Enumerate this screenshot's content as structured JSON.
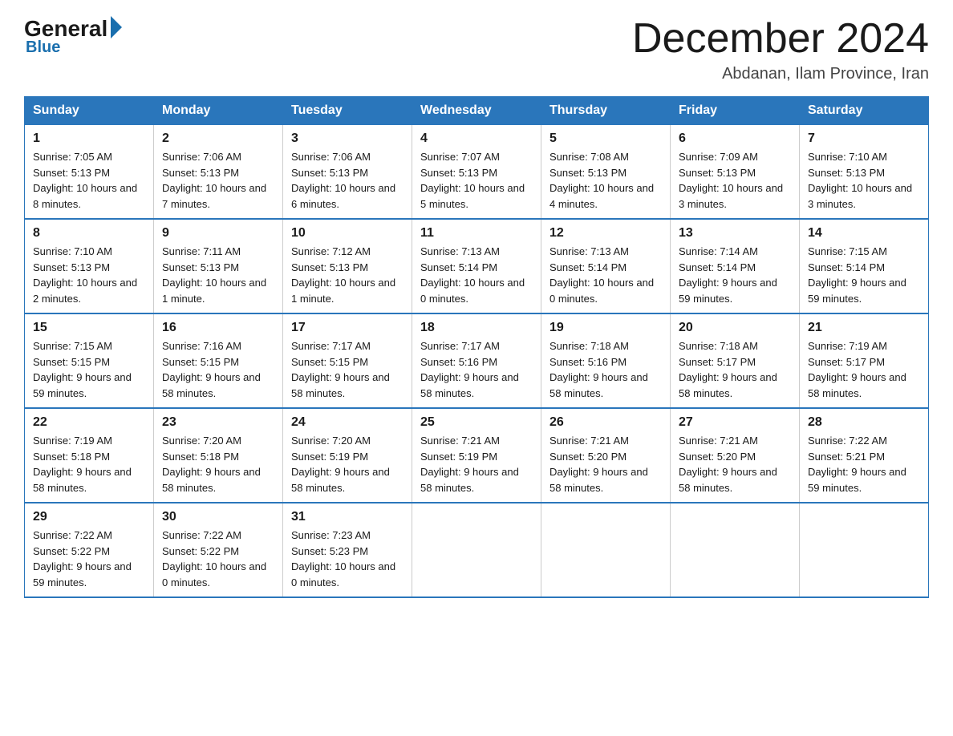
{
  "header": {
    "logo_general": "General",
    "logo_blue": "Blue",
    "month_title": "December 2024",
    "location": "Abdanan, Ilam Province, Iran"
  },
  "days_of_week": [
    "Sunday",
    "Monday",
    "Tuesday",
    "Wednesday",
    "Thursday",
    "Friday",
    "Saturday"
  ],
  "weeks": [
    [
      {
        "day": "1",
        "sunrise": "7:05 AM",
        "sunset": "5:13 PM",
        "daylight": "10 hours and 8 minutes."
      },
      {
        "day": "2",
        "sunrise": "7:06 AM",
        "sunset": "5:13 PM",
        "daylight": "10 hours and 7 minutes."
      },
      {
        "day": "3",
        "sunrise": "7:06 AM",
        "sunset": "5:13 PM",
        "daylight": "10 hours and 6 minutes."
      },
      {
        "day": "4",
        "sunrise": "7:07 AM",
        "sunset": "5:13 PM",
        "daylight": "10 hours and 5 minutes."
      },
      {
        "day": "5",
        "sunrise": "7:08 AM",
        "sunset": "5:13 PM",
        "daylight": "10 hours and 4 minutes."
      },
      {
        "day": "6",
        "sunrise": "7:09 AM",
        "sunset": "5:13 PM",
        "daylight": "10 hours and 3 minutes."
      },
      {
        "day": "7",
        "sunrise": "7:10 AM",
        "sunset": "5:13 PM",
        "daylight": "10 hours and 3 minutes."
      }
    ],
    [
      {
        "day": "8",
        "sunrise": "7:10 AM",
        "sunset": "5:13 PM",
        "daylight": "10 hours and 2 minutes."
      },
      {
        "day": "9",
        "sunrise": "7:11 AM",
        "sunset": "5:13 PM",
        "daylight": "10 hours and 1 minute."
      },
      {
        "day": "10",
        "sunrise": "7:12 AM",
        "sunset": "5:13 PM",
        "daylight": "10 hours and 1 minute."
      },
      {
        "day": "11",
        "sunrise": "7:13 AM",
        "sunset": "5:14 PM",
        "daylight": "10 hours and 0 minutes."
      },
      {
        "day": "12",
        "sunrise": "7:13 AM",
        "sunset": "5:14 PM",
        "daylight": "10 hours and 0 minutes."
      },
      {
        "day": "13",
        "sunrise": "7:14 AM",
        "sunset": "5:14 PM",
        "daylight": "9 hours and 59 minutes."
      },
      {
        "day": "14",
        "sunrise": "7:15 AM",
        "sunset": "5:14 PM",
        "daylight": "9 hours and 59 minutes."
      }
    ],
    [
      {
        "day": "15",
        "sunrise": "7:15 AM",
        "sunset": "5:15 PM",
        "daylight": "9 hours and 59 minutes."
      },
      {
        "day": "16",
        "sunrise": "7:16 AM",
        "sunset": "5:15 PM",
        "daylight": "9 hours and 58 minutes."
      },
      {
        "day": "17",
        "sunrise": "7:17 AM",
        "sunset": "5:15 PM",
        "daylight": "9 hours and 58 minutes."
      },
      {
        "day": "18",
        "sunrise": "7:17 AM",
        "sunset": "5:16 PM",
        "daylight": "9 hours and 58 minutes."
      },
      {
        "day": "19",
        "sunrise": "7:18 AM",
        "sunset": "5:16 PM",
        "daylight": "9 hours and 58 minutes."
      },
      {
        "day": "20",
        "sunrise": "7:18 AM",
        "sunset": "5:17 PM",
        "daylight": "9 hours and 58 minutes."
      },
      {
        "day": "21",
        "sunrise": "7:19 AM",
        "sunset": "5:17 PM",
        "daylight": "9 hours and 58 minutes."
      }
    ],
    [
      {
        "day": "22",
        "sunrise": "7:19 AM",
        "sunset": "5:18 PM",
        "daylight": "9 hours and 58 minutes."
      },
      {
        "day": "23",
        "sunrise": "7:20 AM",
        "sunset": "5:18 PM",
        "daylight": "9 hours and 58 minutes."
      },
      {
        "day": "24",
        "sunrise": "7:20 AM",
        "sunset": "5:19 PM",
        "daylight": "9 hours and 58 minutes."
      },
      {
        "day": "25",
        "sunrise": "7:21 AM",
        "sunset": "5:19 PM",
        "daylight": "9 hours and 58 minutes."
      },
      {
        "day": "26",
        "sunrise": "7:21 AM",
        "sunset": "5:20 PM",
        "daylight": "9 hours and 58 minutes."
      },
      {
        "day": "27",
        "sunrise": "7:21 AM",
        "sunset": "5:20 PM",
        "daylight": "9 hours and 58 minutes."
      },
      {
        "day": "28",
        "sunrise": "7:22 AM",
        "sunset": "5:21 PM",
        "daylight": "9 hours and 59 minutes."
      }
    ],
    [
      {
        "day": "29",
        "sunrise": "7:22 AM",
        "sunset": "5:22 PM",
        "daylight": "9 hours and 59 minutes."
      },
      {
        "day": "30",
        "sunrise": "7:22 AM",
        "sunset": "5:22 PM",
        "daylight": "10 hours and 0 minutes."
      },
      {
        "day": "31",
        "sunrise": "7:23 AM",
        "sunset": "5:23 PM",
        "daylight": "10 hours and 0 minutes."
      },
      null,
      null,
      null,
      null
    ]
  ]
}
